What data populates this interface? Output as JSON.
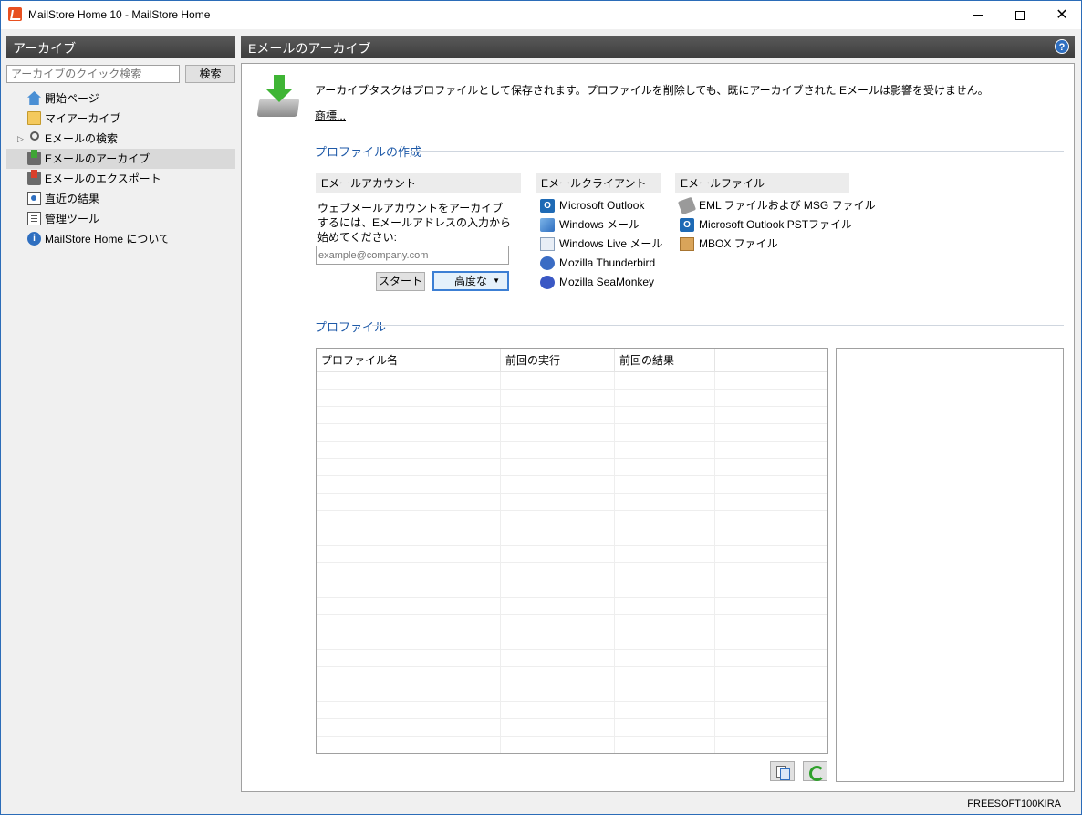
{
  "window": {
    "title": "MailStore Home 10 - MailStore Home"
  },
  "sidebar": {
    "header": "アーカイブ",
    "search_placeholder": "アーカイブのクイック検索",
    "search_button": "検索",
    "items": [
      {
        "label": "開始ページ",
        "icon": "home-icon"
      },
      {
        "label": "マイアーカイブ",
        "icon": "folder-icon"
      },
      {
        "label": "Eメールの検索",
        "icon": "magnifier-icon"
      },
      {
        "label": "Eメールのアーカイブ",
        "icon": "archive-icon",
        "selected": true
      },
      {
        "label": "Eメールのエクスポート",
        "icon": "export-icon"
      },
      {
        "label": "直近の結果",
        "icon": "recent-results-icon"
      },
      {
        "label": "管理ツール",
        "icon": "tools-icon"
      },
      {
        "label": "MailStore Home について",
        "icon": "info-icon"
      }
    ]
  },
  "main": {
    "header": "Eメールのアーカイブ",
    "help_glyph": "?",
    "intro": "アーカイブタスクはプロファイルとして保存されます。プロファイルを削除しても、既にアーカイブされた Eメールは影響を受けません。",
    "trademark_link": "商標...",
    "create_profile_title": "プロファイルの作成",
    "email_account": {
      "header": "Eメールアカウント",
      "description": "ウェブメールアカウントをアーカイブするには、Eメールアドレスの入力から始めてください:",
      "input_placeholder": "example@company.com",
      "start_button": "スタート",
      "advanced_button": "高度な"
    },
    "email_client": {
      "header": "Eメールクライアント",
      "items": [
        {
          "label": "Microsoft Outlook",
          "icon": "outlook-icon"
        },
        {
          "label": "Windows メール",
          "icon": "windows-mail-icon"
        },
        {
          "label": "Windows Live メール",
          "icon": "windows-live-mail-icon"
        },
        {
          "label": "Mozilla Thunderbird",
          "icon": "thunderbird-icon"
        },
        {
          "label": "Mozilla SeaMonkey",
          "icon": "seamonkey-icon"
        }
      ]
    },
    "email_file": {
      "header": "Eメールファイル",
      "items": [
        {
          "label": "EML ファイルおよび MSG ファイル",
          "icon": "eml-file-icon"
        },
        {
          "label": "Microsoft Outlook PSTファイル",
          "icon": "pst-file-icon"
        },
        {
          "label": "MBOX ファイル",
          "icon": "mbox-file-icon"
        }
      ]
    },
    "profiles_title": "プロファイル",
    "profiles_table": {
      "columns": [
        "プロファイル名",
        "前回の実行",
        "前回の結果",
        ""
      ],
      "rows": []
    }
  },
  "statusbar": {
    "text": "FREESOFT100KIRA"
  },
  "colors": {
    "header_bg": "#4a4a4a",
    "section_title": "#1f5aa8",
    "selected_item": "#d9d9d9",
    "focus_border": "#3c7fd4"
  }
}
